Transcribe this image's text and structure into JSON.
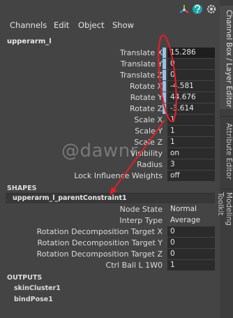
{
  "menu": {
    "channels": "Channels",
    "edit": "Edit",
    "object": "Object",
    "show": "Show"
  },
  "node": {
    "name": "upperarm_l"
  },
  "attributes": [
    {
      "label": "Translate X",
      "value": "15.286",
      "keyed": true
    },
    {
      "label": "Translate Y",
      "value": "0",
      "keyed": true
    },
    {
      "label": "Translate Z",
      "value": "0",
      "keyed": true
    },
    {
      "label": "Rotate X",
      "value": "-4.581",
      "keyed": true
    },
    {
      "label": "Rotate Y",
      "value": "44.676",
      "keyed": true
    },
    {
      "label": "Rotate Z",
      "value": "-3.614",
      "keyed": true
    },
    {
      "label": "Scale X",
      "value": "1",
      "keyed": false
    },
    {
      "label": "Scale Y",
      "value": "1",
      "keyed": false
    },
    {
      "label": "Scale Z",
      "value": "1",
      "keyed": false
    },
    {
      "label": "Visibility",
      "value": "on",
      "keyed": false
    },
    {
      "label": "Radius",
      "value": "3",
      "keyed": false
    },
    {
      "label": "Lock Influence Weights",
      "value": "off",
      "keyed": false
    }
  ],
  "shapes": {
    "header": "SHAPES",
    "name": "upperarm_l_parentConstraint1",
    "attributes": [
      {
        "label": "Node State",
        "value": "Normal"
      },
      {
        "label": "Interp Type",
        "value": "Average"
      },
      {
        "label": "Rotation Decomposition Target X",
        "value": "0"
      },
      {
        "label": "Rotation Decomposition Target Y",
        "value": "0"
      },
      {
        "label": "Rotation Decomposition Target Z",
        "value": "0"
      },
      {
        "label": "Ctrl Ball L 1W0",
        "value": "1"
      }
    ]
  },
  "outputs": {
    "header": "OUTPUTS",
    "items": [
      "skinCluster1",
      "bindPose1"
    ]
  },
  "sidebar": {
    "tabs": [
      "Channel Box / Layer Editor",
      "Attribute Editor",
      "Modeling Toolkit"
    ]
  },
  "watermark": "@dawnr",
  "colors": {
    "background": "#444444",
    "field": "#2b2b2b",
    "keyed_indicator": "#9ac2e6",
    "annotation": "#e0202a"
  },
  "icons": [
    "axis-gizmo-icon",
    "help-icon",
    "settings-icon"
  ]
}
